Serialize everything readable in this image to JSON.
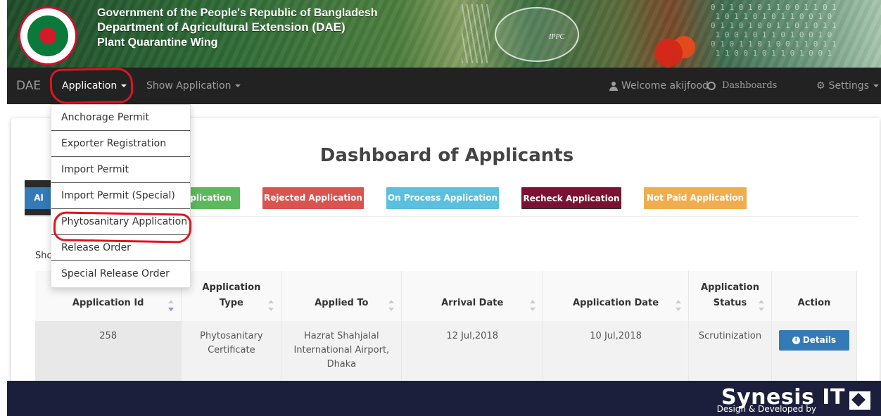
{
  "banner": {
    "line1": "Government of the People's Republic of Bangladesh",
    "line2": "Department of Agricultural Extension (DAE)",
    "line3": "Plant Quarantine Wing",
    "ippc_label": "IPPC"
  },
  "navbar": {
    "brand": "DAE",
    "application": "Application",
    "show_application": "Show Application",
    "welcome": "Welcome akijfood",
    "dashboards": "Dashboards",
    "settings": "Settings"
  },
  "dropdown": {
    "items": [
      {
        "label": "Anchorage Permit"
      },
      {
        "label": "Exporter Registration"
      },
      {
        "label": "Import Permit"
      },
      {
        "label": "Import Permit (Special)"
      },
      {
        "label": "Phytosanitary Application"
      },
      {
        "label": "Release Order"
      },
      {
        "label": "Special Release Order"
      }
    ]
  },
  "dashboard": {
    "title": "Dashboard of Applicants",
    "filters": {
      "all": "Al",
      "approved": "pplication",
      "rejected": "Rejected Application",
      "on_process": "On Process Application",
      "recheck": "Recheck Application",
      "not_paid": "Not Paid Application"
    },
    "show_label": "Sho"
  },
  "table": {
    "headers": {
      "app_id": "Application Id",
      "app_type_1": "Application",
      "app_type_2": "Type",
      "applied_to": "Applied To",
      "arrival": "Arrival Date",
      "app_date": "Application Date",
      "status_1": "Application",
      "status_2": "Status",
      "action": "Action"
    },
    "rows": [
      {
        "id": "258",
        "type_1": "Phytosanitary",
        "type_2": "Certificate",
        "applied_1": "Hazrat Shahjalal",
        "applied_2": "International Airport,",
        "applied_3": "Dhaka",
        "arrival": "12 Jul,2018",
        "app_date": "10 Jul,2018",
        "status": "Scrutinization",
        "action": "Details"
      }
    ]
  },
  "footer": {
    "design_text": "Design & Developed by",
    "company": "Synesis IT"
  },
  "colors": {
    "navbar": "#222222",
    "footer": "#1c1f3c",
    "primary": "#337ab7",
    "annotation_red": "#e0141e"
  }
}
